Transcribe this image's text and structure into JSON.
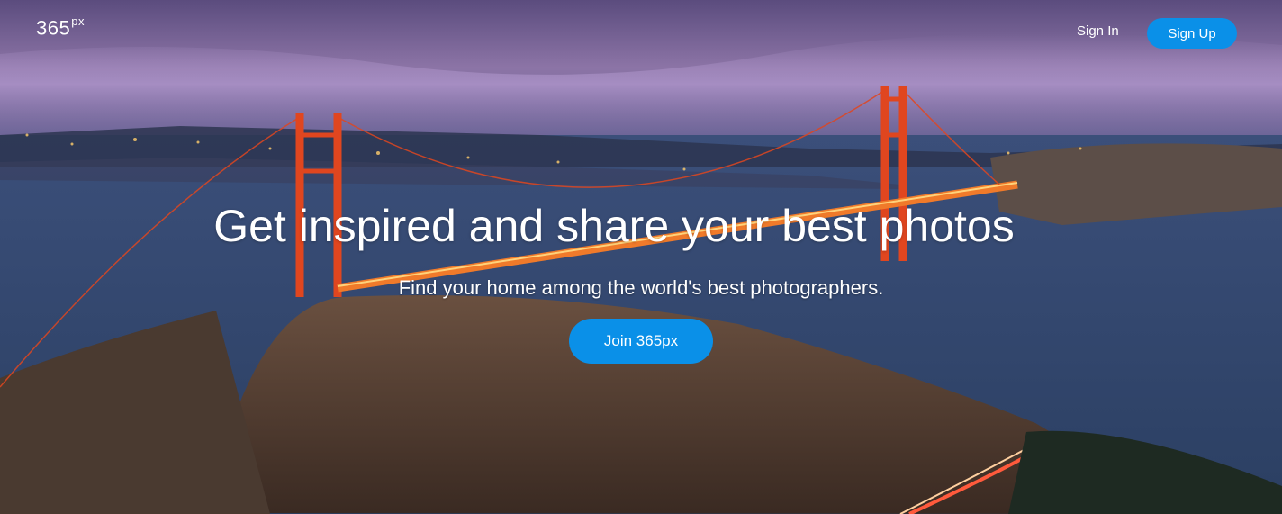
{
  "brand": {
    "logo_main": "365",
    "logo_sup": "px"
  },
  "nav": {
    "sign_in": "Sign In",
    "sign_up": "Sign Up"
  },
  "hero": {
    "headline": "Get inspired and share your best photos",
    "subheadline": "Find your home among the world's best photographers.",
    "cta": "Join 365px"
  },
  "colors": {
    "accent": "#0a90e8",
    "text": "#ffffff"
  }
}
